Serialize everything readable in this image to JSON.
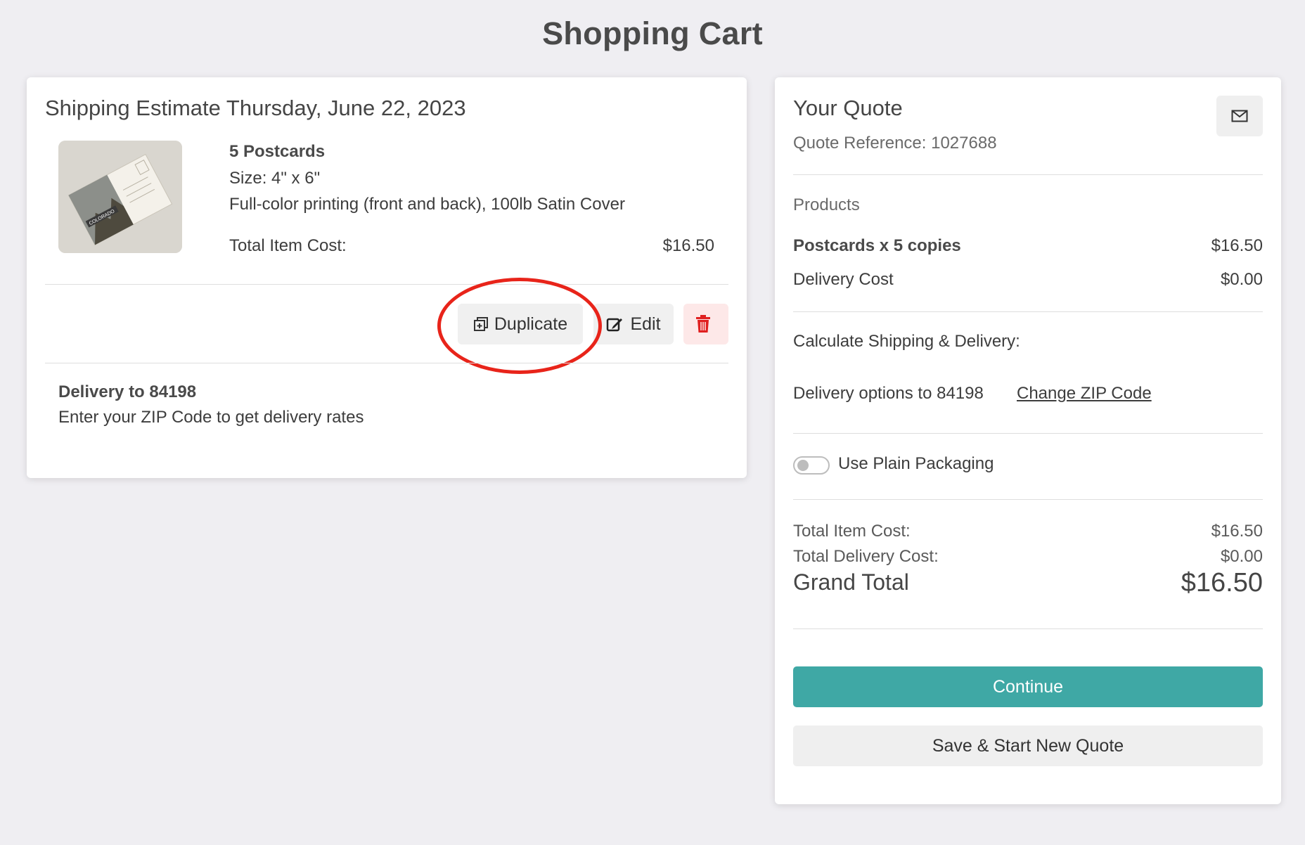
{
  "page": {
    "title": "Shopping Cart"
  },
  "cart": {
    "title": "Shipping Estimate Thursday, June 22, 2023",
    "item": {
      "name": "5 Postcards",
      "size": "Size: 4\" x 6\"",
      "description": "Full-color printing (front and back), 100lb Satin Cover",
      "cost_label": "Total Item Cost:",
      "cost_value": "$16.50",
      "thumbnail_text": "COLORADO"
    },
    "actions": {
      "duplicate_label": "Duplicate",
      "edit_label": "Edit",
      "delete_icon": "trash-icon"
    },
    "delivery": {
      "heading": "Delivery to 84198",
      "subtext": "Enter your ZIP Code to get delivery rates"
    }
  },
  "quote": {
    "title": "Your Quote",
    "reference": "Quote Reference: 1027688",
    "mail_icon": "envelope-icon",
    "products_label": "Products",
    "product_line": {
      "label": "Postcards x 5 copies",
      "value": "$16.50"
    },
    "delivery_cost": {
      "label": "Delivery Cost",
      "value": "$0.00"
    },
    "calc_label": "Calculate Shipping & Delivery:",
    "delivery_options": {
      "label": "Delivery options to 84198",
      "link": "Change ZIP Code"
    },
    "plain_packaging": {
      "label": "Use Plain Packaging",
      "enabled": false
    },
    "totals": {
      "item_label": "Total Item Cost:",
      "item_value": "$16.50",
      "delivery_label": "Total Delivery Cost:",
      "delivery_value": "$0.00",
      "grand_label": "Grand Total",
      "grand_value": "$16.50"
    },
    "continue_label": "Continue",
    "save_label": "Save & Start New Quote"
  },
  "colors": {
    "accent": "#3fa8a5",
    "delete_bg": "#fde8e8",
    "delete_icon": "#e02020",
    "highlight": "#e8241a"
  }
}
